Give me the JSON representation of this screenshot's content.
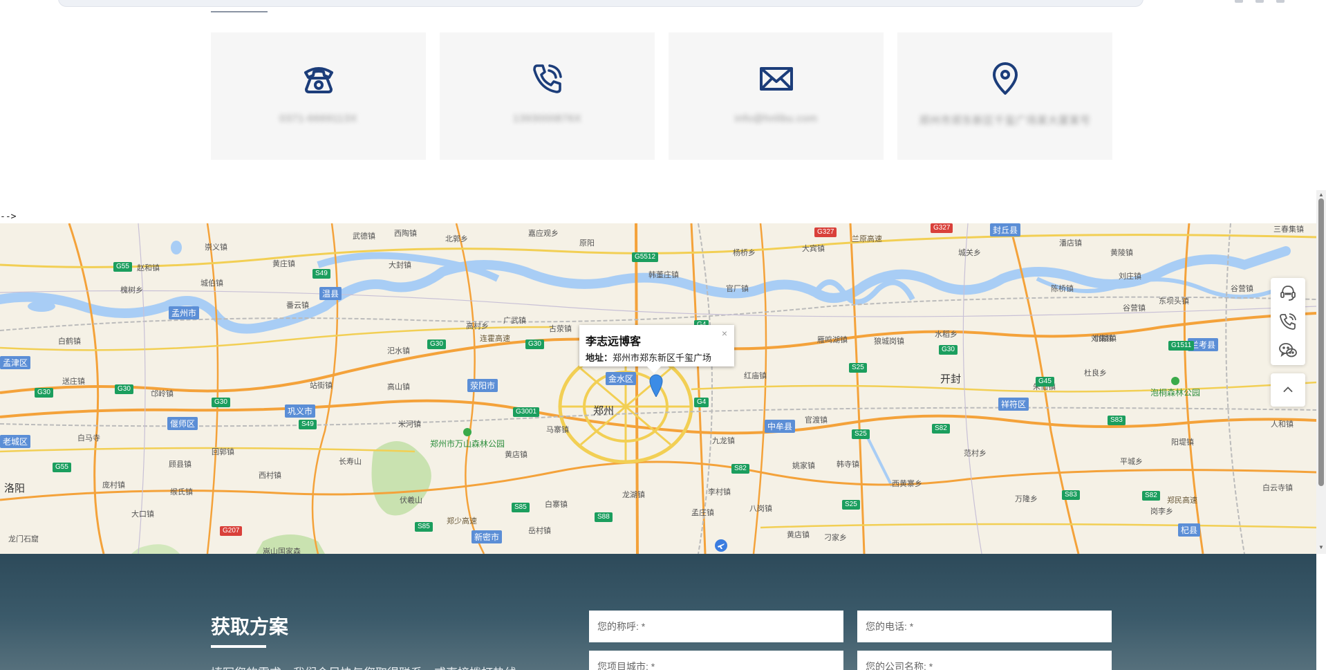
{
  "contact": {
    "cards": [
      {
        "icon": "telephone-icon",
        "value": "0371-6669113X"
      },
      {
        "icon": "phone-call-icon",
        "value": "1393000876X"
      },
      {
        "icon": "mail-icon",
        "value": "info@hnlibu.com"
      },
      {
        "icon": "location-pin-icon",
        "value": "郑州市郑东新区千玺广场某大厦某号"
      }
    ]
  },
  "html_comment_artifact": "-->",
  "map": {
    "info_window": {
      "title": "李志远博客",
      "address_label": "地址：",
      "address": "郑州市郑东新区千玺广场",
      "close": "×"
    },
    "cities": [
      {
        "name": "郑州"
      },
      {
        "name": "开封"
      },
      {
        "name": "洛阳"
      }
    ],
    "districts": [
      "孟州市",
      "温县",
      "荥阳市",
      "金水区",
      "巩义市",
      "偃师区",
      "中牟县",
      "祥符区",
      "新密市",
      "杞县",
      "兰考县",
      "孟津区",
      "封丘县",
      "老城区"
    ],
    "towns": [
      "武德镇",
      "西陶镇",
      "北郭乡",
      "嘉应观乡",
      "原阳",
      "大宾镇",
      "兰原高速",
      "城关乡",
      "潘店镇",
      "黄陵镇",
      "三春集镇",
      "崇义镇",
      "赵和镇",
      "黄庄镇",
      "大封镇",
      "韩董庄镇",
      "官厂镇",
      "陈桥镇",
      "刘庄镇",
      "东坝头镇",
      "谷营镇",
      "槐树乡",
      "城伯镇",
      "番云镇",
      "高村乡",
      "广武镇",
      "古荥镇",
      "杨桥乡",
      "雁鸣湖镇",
      "狼城岗镇",
      "水稻乡",
      "仇楼镇",
      "谷营镇",
      "白鹤镇",
      "汜水镇",
      "连霍高速",
      "刘集镇",
      "杜良乡",
      "红庙镇",
      "送庄镇",
      "站街镇",
      "高山镇",
      "邙岭镇",
      "白马寺",
      "米河镇",
      "马寨镇",
      "九龙镇",
      "官渡镇",
      "朱仙镇",
      "人和镇",
      "顾县镇",
      "回郭镇",
      "长寿山",
      "黄店镇",
      "八岗镇",
      "姚家镇",
      "韩寺镇",
      "范村乡",
      "西黄寨乡",
      "阳堤镇",
      "庞村镇",
      "缑氏镇",
      "西村镇",
      "伏羲山",
      "白寨镇",
      "龙湖镇",
      "孟庄镇",
      "岗李乡",
      "万隆乡",
      "平城乡",
      "白云寺镇",
      "大口镇",
      "李村镇",
      "岳村镇",
      "黄店镇",
      "刁家乡",
      "郑民高速",
      "郑少高速",
      "龙门石窟",
      "嵩山国家森"
    ],
    "parks": [
      "郑州市万山森林公园",
      "泡桐森林公园"
    ],
    "green_shields": [
      "G55",
      "S49",
      "G30",
      "G3001",
      "G5512",
      "G4",
      "S25",
      "S82",
      "S85",
      "S88",
      "S83",
      "G45",
      "G1511"
    ],
    "red_shields": [
      "G327",
      "G207"
    ]
  },
  "side_tools": [
    {
      "name": "customer-service-icon"
    },
    {
      "name": "phone-call-icon"
    },
    {
      "name": "wechat-icon"
    },
    {
      "name": "back-to-top-icon"
    }
  ],
  "footer": {
    "title": "获取方案",
    "description": "填写您的需求，我们会尽快与您取得联系，或直接拨打热线",
    "fields": [
      {
        "placeholder": "您的称呼: *"
      },
      {
        "placeholder": "您的电话: *"
      },
      {
        "placeholder": "您项目城市: *"
      },
      {
        "placeholder": "您的公司名称: *"
      }
    ]
  },
  "colors": {
    "icon_navy": "#1c3d7a",
    "card_bg": "#f6f6f6",
    "footer_bg": "#2d4a5a",
    "water": "#a8cdf5",
    "road_orange": "#f4a23a",
    "road_yellow": "#f2cf54"
  }
}
